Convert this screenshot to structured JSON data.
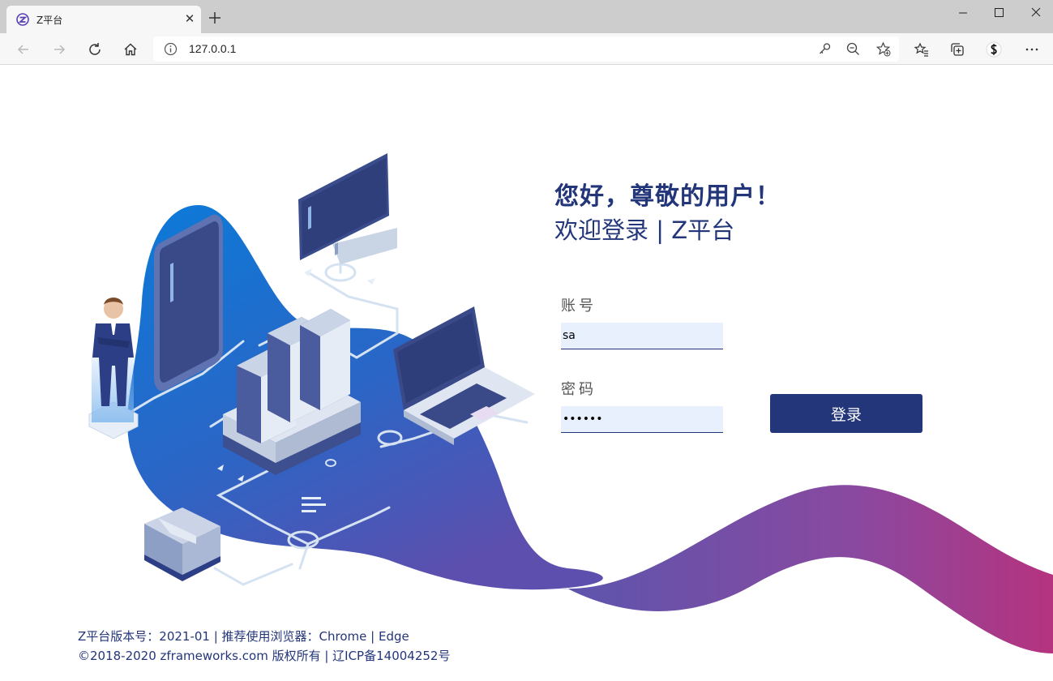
{
  "browser": {
    "tab_title": "Z平台",
    "address": "127.0.0.1"
  },
  "login": {
    "greeting": "您好，尊敬的用户！",
    "subtitle": "欢迎登录 | Z平台",
    "account_label": "账号",
    "account_value": "sa",
    "password_label": "密码",
    "password_value": "••••••",
    "login_button": "登录"
  },
  "footer": {
    "line1": "Z平台版本号：2021-01 | 推荐使用浏览器：Chrome | Edge",
    "line2": "©2018-2020 zframeworks.com 版权所有 | 辽ICP备14004252号"
  },
  "colors": {
    "brand": "#23367a",
    "blob_top": "#0c7ad8",
    "blob_bottom": "#5a4fb0",
    "wave_end": "#b3347f"
  }
}
